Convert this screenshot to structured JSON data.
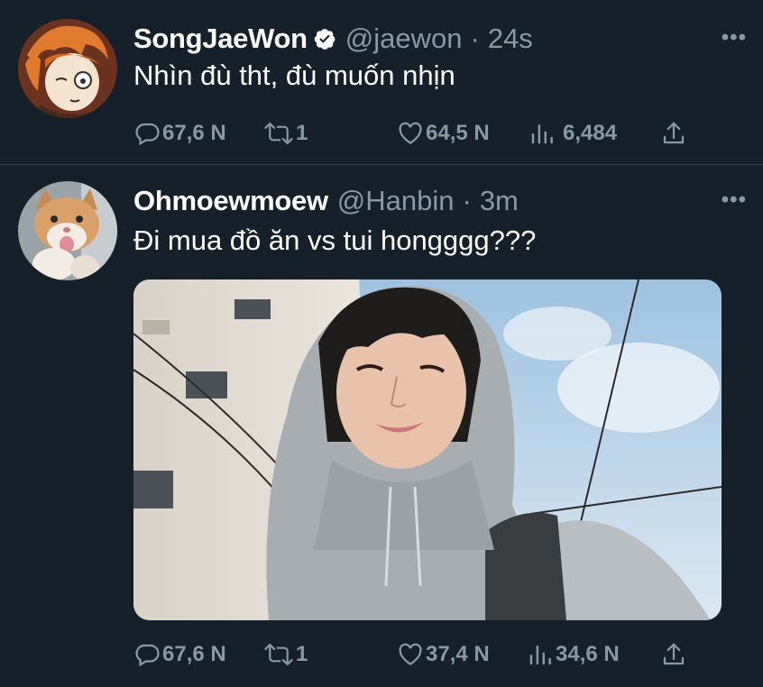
{
  "colors": {
    "background": "#15202b",
    "secondary_text": "#8899a6",
    "divider": "#38444d",
    "verified": "#ffffff"
  },
  "tweets": [
    {
      "name": "SongJaeWon",
      "handle": "@jaewon",
      "separator": "·",
      "time": "24s",
      "text": "Nhìn đù tht, đù muốn nhịn",
      "more": "•••",
      "verified": true,
      "avatar_icon": "anime-avatar-icon",
      "stats": {
        "replies": "67,6 N",
        "retweets": "1",
        "likes": "64,5 N",
        "views": "6,484"
      }
    },
    {
      "name": "Ohmoewmoew",
      "handle": "@Hanbin",
      "separator": "·",
      "time": "3m",
      "text": "Đi mua đồ ăn vs tui hongggg???",
      "more": "•••",
      "verified": false,
      "avatar_icon": "cat-avatar-icon",
      "has_photo": true,
      "stats": {
        "replies": "67,6 N",
        "retweets": "1",
        "likes": "37,4 N",
        "views": "34,6 N"
      }
    }
  ]
}
